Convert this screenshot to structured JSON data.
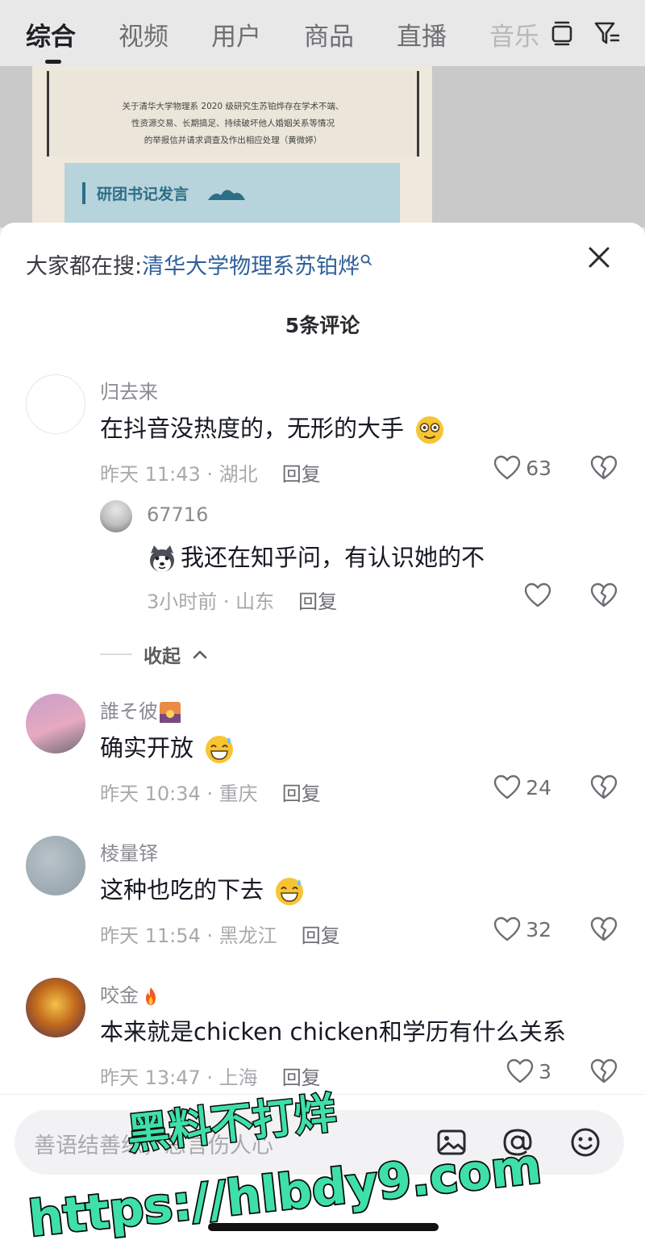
{
  "tabs": [
    {
      "label": "综合"
    },
    {
      "label": "视频"
    },
    {
      "label": "用户"
    },
    {
      "label": "商品"
    },
    {
      "label": "直播"
    },
    {
      "label": "音乐"
    }
  ],
  "top_icons": [
    "layers-icon",
    "filter-icon"
  ],
  "background_doc": {
    "lines": [
      "关于清华大学物理系 2020 级研究生苏铂烨存在学术不端、",
      "性资源交易、长期搞足、持续破坏他人婚姻关系等情况",
      "的举报信并请求调查及作出相应处理（黄微婷）"
    ],
    "heading": "研团书记发言"
  },
  "sheet": {
    "hot_prefix": "大家都在搜:",
    "hot_term": "清华大学物理系苏铂烨",
    "count_title": "5条评论"
  },
  "comments": [
    {
      "user": "归去来",
      "text": "在抖音没热度的，无形的大手",
      "time": "昨天 11:43 · 湖北",
      "reply": "回复",
      "likes": "63"
    },
    {
      "user": "67716",
      "text": "我还在知乎问，有认识她的不",
      "time": "3小时前 · 山东",
      "reply": "回复",
      "likes": ""
    },
    {
      "user": "誰そ彼",
      "text": "确实开放",
      "time": "昨天 10:34 · 重庆",
      "reply": "回复",
      "likes": "24"
    },
    {
      "user": "棱量铎",
      "text": "这种也吃的下去",
      "time": "昨天 11:54 · 黑龙江",
      "reply": "回复",
      "likes": "32"
    },
    {
      "user": "咬金",
      "text": "本来就是chicken chicken和学历有什么关系",
      "time": "昨天 13:47 · 上海",
      "reply": "回复",
      "likes": "3"
    }
  ],
  "collapse_label": "收起",
  "input": {
    "placeholder": "善语结善缘，恶言伤人心"
  },
  "watermark": {
    "line1": "黑料不打烊",
    "line2": "https://hlbdy9.com"
  },
  "colors": {
    "hot_term": "#2f5f9a",
    "watermark_fill": "#3ee0a8",
    "watermark_stroke": "#0a0a0a"
  }
}
